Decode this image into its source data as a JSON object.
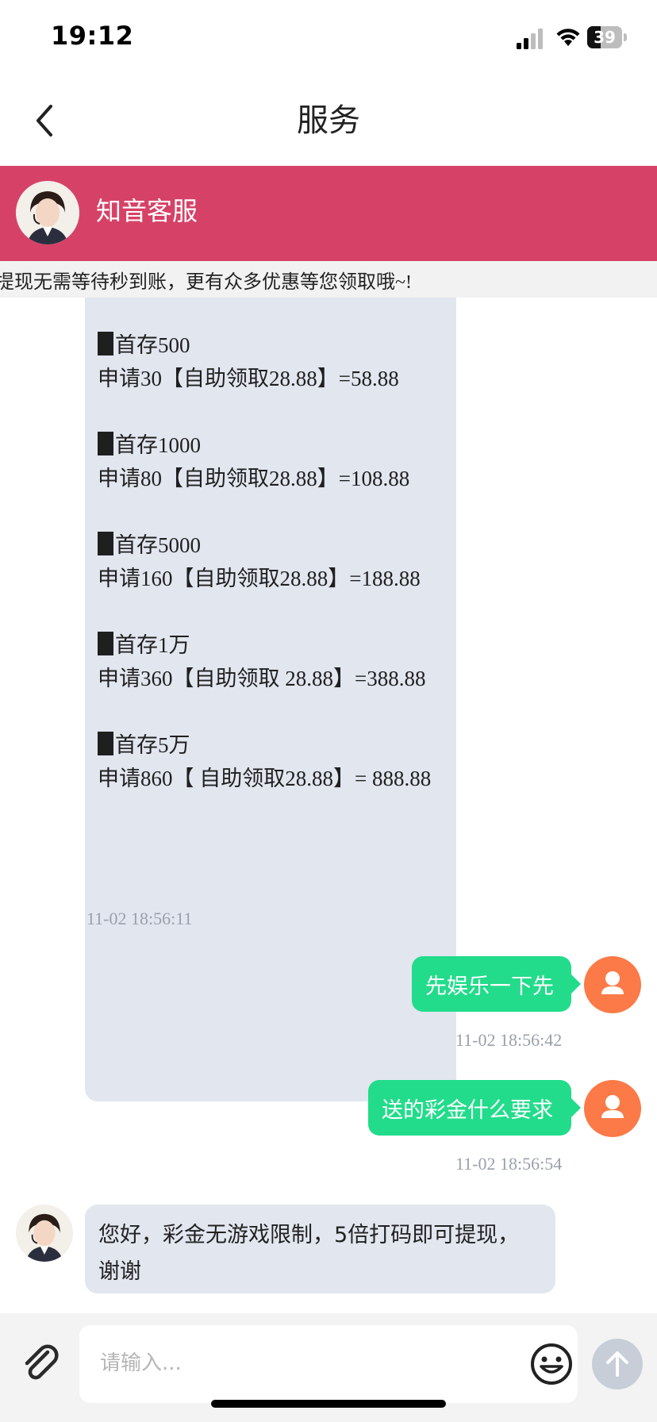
{
  "status_bar": {
    "time": "19:12",
    "battery": "39",
    "battery_level": 0.39
  },
  "nav": {
    "title": "服务"
  },
  "agent": {
    "name": "知音客服"
  },
  "marquee": {
    "text": "提现无需等待秒到账，更有众多优惠等您领取哦~!"
  },
  "messages": {
    "long_offer": {
      "lines": [
        {
          "head": "首存500",
          "detail": "申请30【自助领取28.88】=58.88"
        },
        {
          "head": "首存1000",
          "detail": "申请80【自助领取28.88】=108.88"
        },
        {
          "head": "首存5000",
          "detail": "申请160【自助领取28.88】=188.88"
        },
        {
          "head": "首存1万",
          "detail": "申请360【自助领取 28.88】=388.88"
        },
        {
          "head": "首存5万",
          "detail": "申请860【 自助领取28.88】= 888.88"
        }
      ],
      "time": "11-02 18:56:11"
    },
    "out1": {
      "text": "先娱乐一下先",
      "time": "11-02 18:56:42"
    },
    "out2": {
      "text": "送的彩金什么要求",
      "time": "11-02 18:56:54"
    },
    "reply": {
      "line1": "您好，彩金无游戏限制，5倍打码即可提现，",
      "line2": "谢谢"
    }
  },
  "composer": {
    "placeholder": "请输入..."
  },
  "colors": {
    "header": "#d64267",
    "outgoing": "#22dc8b",
    "incoming": "#e2e6ef",
    "user_avatar": "#fb7a47"
  },
  "icons": [
    "back-chevron-icon",
    "signal-icon",
    "wifi-icon",
    "battery-icon",
    "paperclip-icon",
    "emoji-icon",
    "send-arrow-icon",
    "user-icon"
  ]
}
